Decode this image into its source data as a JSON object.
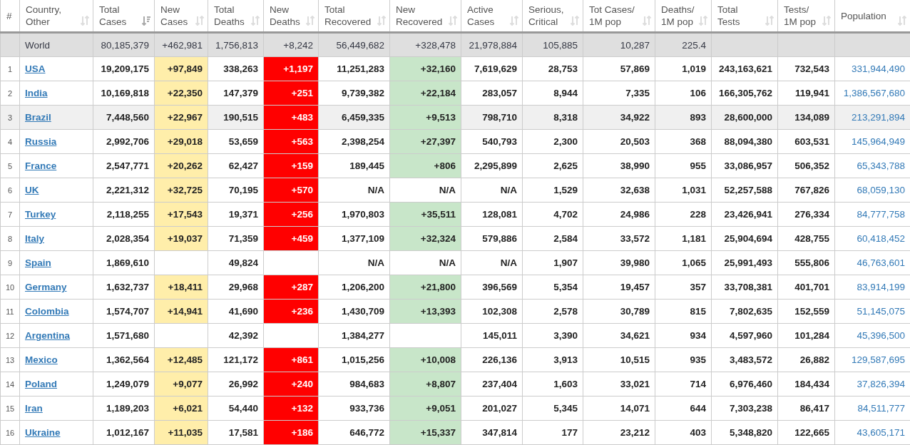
{
  "columns": [
    {
      "label": "#",
      "kind": "rank"
    },
    {
      "label": "Country, Other",
      "kind": "country",
      "sorted": false
    },
    {
      "label": "Total Cases",
      "kind": "number",
      "sorted": true
    },
    {
      "label": "New Cases",
      "kind": "new_cases",
      "sorted": false
    },
    {
      "label": "Total Deaths",
      "kind": "number",
      "sorted": false
    },
    {
      "label": "New Deaths",
      "kind": "new_deaths",
      "sorted": false
    },
    {
      "label": "Total Recovered",
      "kind": "number",
      "sorted": false
    },
    {
      "label": "New Recovered",
      "kind": "new_recovered",
      "sorted": false
    },
    {
      "label": "Active Cases",
      "kind": "number",
      "sorted": false
    },
    {
      "label": "Serious, Critical",
      "kind": "number",
      "sorted": false
    },
    {
      "label": "Tot Cases/ 1M pop",
      "kind": "number",
      "sorted": false
    },
    {
      "label": "Deaths/ 1M pop",
      "kind": "number",
      "sorted": false
    },
    {
      "label": "Total Tests",
      "kind": "number",
      "sorted": false
    },
    {
      "label": "Tests/ 1M pop",
      "kind": "number",
      "sorted": false
    },
    {
      "label": "Population",
      "kind": "population",
      "sorted": false
    }
  ],
  "rows": [
    {
      "kind": "total",
      "cells": [
        null,
        "World",
        "80,185,379",
        "+462,981",
        "1,756,813",
        "+8,242",
        "56,449,682",
        "+328,478",
        "21,978,884",
        "105,885",
        "10,287",
        "225.4",
        null,
        null,
        null
      ]
    },
    {
      "kind": "country",
      "highlighted": false,
      "cells": [
        "1",
        "USA",
        "19,209,175",
        "+97,849",
        "338,263",
        "+1,197",
        "11,251,283",
        "+32,160",
        "7,619,629",
        "28,753",
        "57,869",
        "1,019",
        "243,163,621",
        "732,543",
        "331,944,490"
      ]
    },
    {
      "kind": "country",
      "highlighted": false,
      "cells": [
        "2",
        "India",
        "10,169,818",
        "+22,350",
        "147,379",
        "+251",
        "9,739,382",
        "+22,184",
        "283,057",
        "8,944",
        "7,335",
        "106",
        "166,305,762",
        "119,941",
        "1,386,567,680"
      ]
    },
    {
      "kind": "country",
      "highlighted": true,
      "cells": [
        "3",
        "Brazil",
        "7,448,560",
        "+22,967",
        "190,515",
        "+483",
        "6,459,335",
        "+9,513",
        "798,710",
        "8,318",
        "34,922",
        "893",
        "28,600,000",
        "134,089",
        "213,291,894"
      ]
    },
    {
      "kind": "country",
      "highlighted": false,
      "cells": [
        "4",
        "Russia",
        "2,992,706",
        "+29,018",
        "53,659",
        "+563",
        "2,398,254",
        "+27,397",
        "540,793",
        "2,300",
        "20,503",
        "368",
        "88,094,380",
        "603,531",
        "145,964,949"
      ]
    },
    {
      "kind": "country",
      "highlighted": false,
      "cells": [
        "5",
        "France",
        "2,547,771",
        "+20,262",
        "62,427",
        "+159",
        "189,445",
        "+806",
        "2,295,899",
        "2,625",
        "38,990",
        "955",
        "33,086,957",
        "506,352",
        "65,343,788"
      ]
    },
    {
      "kind": "country",
      "highlighted": false,
      "cells": [
        "6",
        "UK",
        "2,221,312",
        "+32,725",
        "70,195",
        "+570",
        "N/A",
        {
          "text": "N/A",
          "tinted": false
        },
        "N/A",
        "1,529",
        "32,638",
        "1,031",
        "52,257,588",
        "767,826",
        "68,059,130"
      ]
    },
    {
      "kind": "country",
      "highlighted": false,
      "cells": [
        "7",
        "Turkey",
        "2,118,255",
        "+17,543",
        "19,371",
        "+256",
        "1,970,803",
        "+35,511",
        "128,081",
        "4,702",
        "24,986",
        "228",
        "23,426,941",
        "276,334",
        "84,777,758"
      ]
    },
    {
      "kind": "country",
      "highlighted": false,
      "cells": [
        "8",
        "Italy",
        "2,028,354",
        "+19,037",
        "71,359",
        "+459",
        "1,377,109",
        "+32,324",
        "579,886",
        "2,584",
        "33,572",
        "1,181",
        "25,904,694",
        "428,755",
        "60,418,452"
      ]
    },
    {
      "kind": "country",
      "highlighted": false,
      "cells": [
        "9",
        "Spain",
        "1,869,610",
        null,
        "49,824",
        null,
        "N/A",
        {
          "text": "N/A",
          "tinted": false
        },
        "N/A",
        "1,907",
        "39,980",
        "1,065",
        "25,991,493",
        "555,806",
        "46,763,601"
      ]
    },
    {
      "kind": "country",
      "highlighted": false,
      "cells": [
        "10",
        "Germany",
        "1,632,737",
        "+18,411",
        "29,968",
        "+287",
        "1,206,200",
        "+21,800",
        "396,569",
        "5,354",
        "19,457",
        "357",
        "33,708,381",
        "401,701",
        "83,914,199"
      ]
    },
    {
      "kind": "country",
      "highlighted": false,
      "cells": [
        "11",
        "Colombia",
        "1,574,707",
        "+14,941",
        "41,690",
        "+236",
        "1,430,709",
        "+13,393",
        "102,308",
        "2,578",
        "30,789",
        "815",
        "7,802,635",
        "152,559",
        "51,145,075"
      ]
    },
    {
      "kind": "country",
      "highlighted": false,
      "cells": [
        "12",
        "Argentina",
        "1,571,680",
        null,
        "42,392",
        null,
        "1,384,277",
        null,
        "145,011",
        "3,390",
        "34,621",
        "934",
        "4,597,960",
        "101,284",
        "45,396,500"
      ]
    },
    {
      "kind": "country",
      "highlighted": false,
      "cells": [
        "13",
        "Mexico",
        "1,362,564",
        "+12,485",
        "121,172",
        "+861",
        "1,015,256",
        "+10,008",
        "226,136",
        "3,913",
        "10,515",
        "935",
        "3,483,572",
        "26,882",
        "129,587,695"
      ]
    },
    {
      "kind": "country",
      "highlighted": false,
      "cells": [
        "14",
        "Poland",
        "1,249,079",
        "+9,077",
        "26,992",
        "+240",
        "984,683",
        "+8,807",
        "237,404",
        "1,603",
        "33,021",
        "714",
        "6,976,460",
        "184,434",
        "37,826,394"
      ]
    },
    {
      "kind": "country",
      "highlighted": false,
      "cells": [
        "15",
        "Iran",
        "1,189,203",
        "+6,021",
        "54,440",
        "+132",
        "933,736",
        "+9,051",
        "201,027",
        "5,345",
        "14,071",
        "644",
        "7,303,238",
        "86,417",
        "84,511,777"
      ]
    },
    {
      "kind": "country",
      "highlighted": false,
      "cells": [
        "16",
        "Ukraine",
        "1,012,167",
        "+11,035",
        "17,581",
        "+186",
        "646,772",
        "+15,337",
        "347,814",
        "177",
        "23,212",
        "403",
        "5,348,820",
        "122,665",
        "43,605,171"
      ]
    }
  ]
}
